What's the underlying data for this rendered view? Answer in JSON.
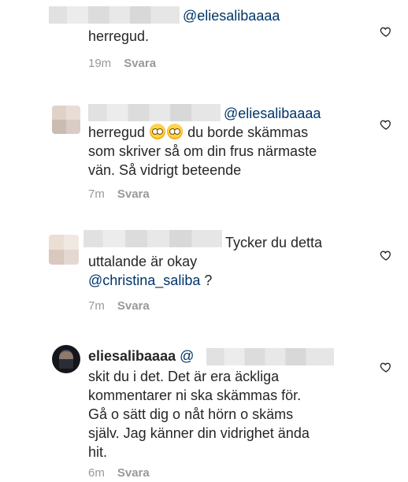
{
  "comments": [
    {
      "mention": "@eliesalibaaaa",
      "body": "herregud.",
      "time": "19m",
      "reply_label": "Svara"
    },
    {
      "mention": "@eliesalibaaaa",
      "line1_prefix": "herregud",
      "line1_suffix": "du borde skämmas",
      "line2": "som skriver så om din frus närmaste",
      "line3": "vän. Så vidrigt beteende",
      "time": "7m",
      "reply_label": "Svara"
    },
    {
      "line1": "Tycker du detta",
      "line2": "uttalande är okay",
      "mention": "@christina_saliba",
      "line3_suffix": " ?",
      "time": "7m",
      "reply_label": "Svara"
    },
    {
      "username": "eliesalibaaaa",
      "mention_prefix": "@",
      "line1": "skit du i det. Det är era äckliga",
      "line2": "kommentarer ni ska skämmas för.",
      "line3": "Gå o sätt dig o nåt hörn o skäms",
      "line4": "själv. Jag känner din vidrighet ända",
      "line5": "hit.",
      "time": "6m",
      "reply_label": "Svara"
    }
  ],
  "icons": {
    "like": "heart-outline-icon",
    "avatar_blurred": "pixelated-avatar",
    "avatar_user": "profile-photo"
  },
  "colors": {
    "text": "#262626",
    "mention": "#003569",
    "meta": "#999999"
  }
}
